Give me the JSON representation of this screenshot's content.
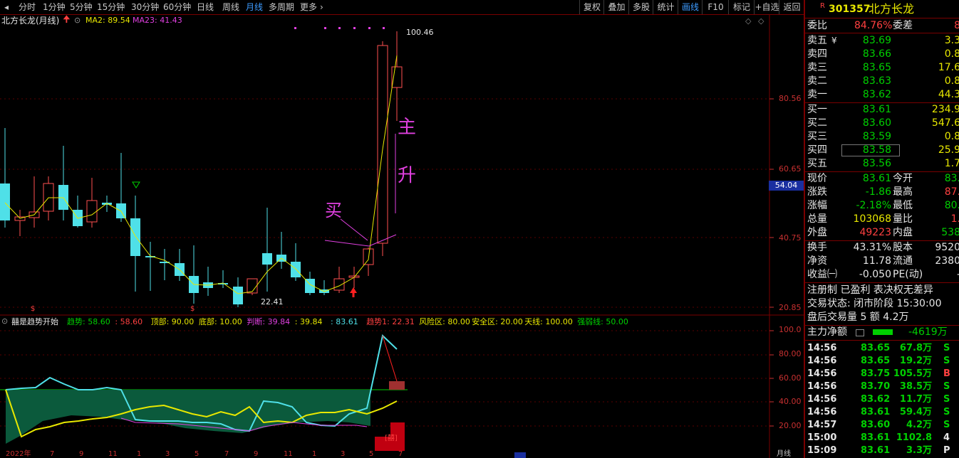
{
  "toolbar": {
    "periods": [
      "分时",
      "1分钟",
      "5分钟",
      "15分钟",
      "30分钟",
      "60分钟",
      "日线",
      "周线",
      "月线",
      "多周期",
      "更多"
    ],
    "active_period": "月线",
    "actions": [
      "复权",
      "叠加",
      "多股",
      "统计",
      "画线",
      "F10",
      "标记",
      "+自选",
      "返回"
    ],
    "active_action": "画线"
  },
  "main": {
    "name": "北方长龙(月线)",
    "ma_labels": [
      "MA2: 89.54",
      "MA23: 41.43"
    ],
    "ma_colors": {
      "ma2": "#e8e800",
      "ma23": "#e040e0"
    },
    "price_axis": [
      "80.56",
      "60.65",
      "40.75",
      "20.85"
    ],
    "current_price_tag": "54.04",
    "high_marker": "100.46",
    "low_marker": "22.41",
    "annotations": {
      "buy": "买",
      "main": "主",
      "rise": "升"
    },
    "s_markers": [
      "$",
      "$"
    ]
  },
  "indicator": {
    "name": "囍是趋势开始",
    "params": [
      {
        "text": "趋势: 58.60",
        "color": "#00d000"
      },
      {
        "text": ": 58.60",
        "color": "#ff4040"
      },
      {
        "text": "顶部: 90.00",
        "color": "#e8e800"
      },
      {
        "text": "底部: 10.00",
        "color": "#e8e800"
      },
      {
        "text": "判断: 39.84",
        "color": "#e040e0"
      },
      {
        "text": ": 39.84",
        "color": "#e8e800"
      },
      {
        "text": ": 83.61",
        "color": "#4fe0e8"
      },
      {
        "text": "趋势1: 22.31",
        "color": "#ff4040"
      },
      {
        "text": "风险区: 80.00",
        "color": "#e8e800"
      },
      {
        "text": "安全区: 20.00",
        "color": "#e8e800"
      },
      {
        "text": "天线: 100.00",
        "color": "#e8e800"
      },
      {
        "text": "强弱线: 50.00",
        "color": "#00d000"
      }
    ],
    "axis": [
      "100.0",
      "80.00",
      "60.00",
      "40.00",
      "20.00"
    ],
    "signal_label": "[囍]",
    "bottom_axis": [
      "2022年",
      "7",
      "9",
      "11",
      "1",
      "3",
      "5",
      "7",
      "9",
      "11",
      "1",
      "3",
      "5",
      "7"
    ],
    "bottom_right": "月线"
  },
  "panel": {
    "code": "301357",
    "name": "北方长龙",
    "weibi_label": "委比",
    "weibi_value": "84.76%",
    "weicha_label": "委差",
    "weicha_value": "8",
    "asks": [
      {
        "label": "卖五",
        "flag": "¥",
        "price": "83.69",
        "vol": "3.3"
      },
      {
        "label": "卖四",
        "flag": "",
        "price": "83.66",
        "vol": "0.8"
      },
      {
        "label": "卖三",
        "flag": "",
        "price": "83.65",
        "vol": "17.6"
      },
      {
        "label": "卖二",
        "flag": "",
        "price": "83.63",
        "vol": "0.8"
      },
      {
        "label": "卖一",
        "flag": "",
        "price": "83.62",
        "vol": "44.3"
      }
    ],
    "bids": [
      {
        "label": "买一",
        "price": "83.61",
        "vol": "234.9"
      },
      {
        "label": "买二",
        "price": "83.60",
        "vol": "547.6"
      },
      {
        "label": "买三",
        "price": "83.59",
        "vol": "0.8"
      },
      {
        "label": "买四",
        "price": "83.58",
        "vol": "25.9"
      },
      {
        "label": "买五",
        "price": "83.56",
        "vol": "1.7"
      }
    ],
    "stats": [
      {
        "l1": "现价",
        "v1": "83.61",
        "c1": "#00d000",
        "l2": "今开",
        "v2": "83.",
        "c2": "#00d000"
      },
      {
        "l1": "涨跌",
        "v1": "-1.86",
        "c1": "#00d000",
        "l2": "最高",
        "v2": "87.",
        "c2": "#ff4040"
      },
      {
        "l1": "涨幅",
        "v1": "-2.18%",
        "c1": "#00d000",
        "l2": "最低",
        "v2": "80.",
        "c2": "#00d000"
      },
      {
        "l1": "总量",
        "v1": "103068",
        "c1": "#e8e800",
        "l2": "量比",
        "v2": "1.",
        "c2": "#ff4040"
      },
      {
        "l1": "外盘",
        "v1": "49223",
        "c1": "#ff4040",
        "l2": "内盘",
        "v2": "538",
        "c2": "#00d000"
      }
    ],
    "stats2": [
      {
        "l1": "换手",
        "v1": "43.31%",
        "l2": "股本",
        "v2": "9520"
      },
      {
        "l1": "净资",
        "v1": "11.78",
        "l2": "流通",
        "v2": "2380"
      },
      {
        "l1": "收益㈠",
        "v1": "-0.050",
        "l2": "PE(动)",
        "v2": "-"
      }
    ],
    "notice": "注册制 已盈利 表决权无差异",
    "trade_status": "交易状态: 闭市阶段 15:30:00",
    "after_hours": "盘后交易量 5 额 4.2万",
    "flow_label": "主力净额",
    "flow_value": "-4619万",
    "ticks": [
      {
        "time": "14:56",
        "price": "83.65",
        "vol": "67.8万",
        "side": "S"
      },
      {
        "time": "14:56",
        "price": "83.65",
        "vol": "19.2万",
        "side": "S"
      },
      {
        "time": "14:56",
        "price": "83.75",
        "vol": "105.5万",
        "side": "B"
      },
      {
        "time": "14:56",
        "price": "83.70",
        "vol": "38.5万",
        "side": "S"
      },
      {
        "time": "14:56",
        "price": "83.62",
        "vol": "11.7万",
        "side": "S"
      },
      {
        "time": "14:56",
        "price": "83.61",
        "vol": "59.4万",
        "side": "S"
      },
      {
        "time": "14:57",
        "price": "83.60",
        "vol": "4.2万",
        "side": "S"
      },
      {
        "time": "15:00",
        "price": "83.61",
        "vol": "1102.8万",
        "side": "4"
      },
      {
        "time": "15:09",
        "price": "83.61",
        "vol": "3.3万",
        "side": "P"
      }
    ]
  }
}
